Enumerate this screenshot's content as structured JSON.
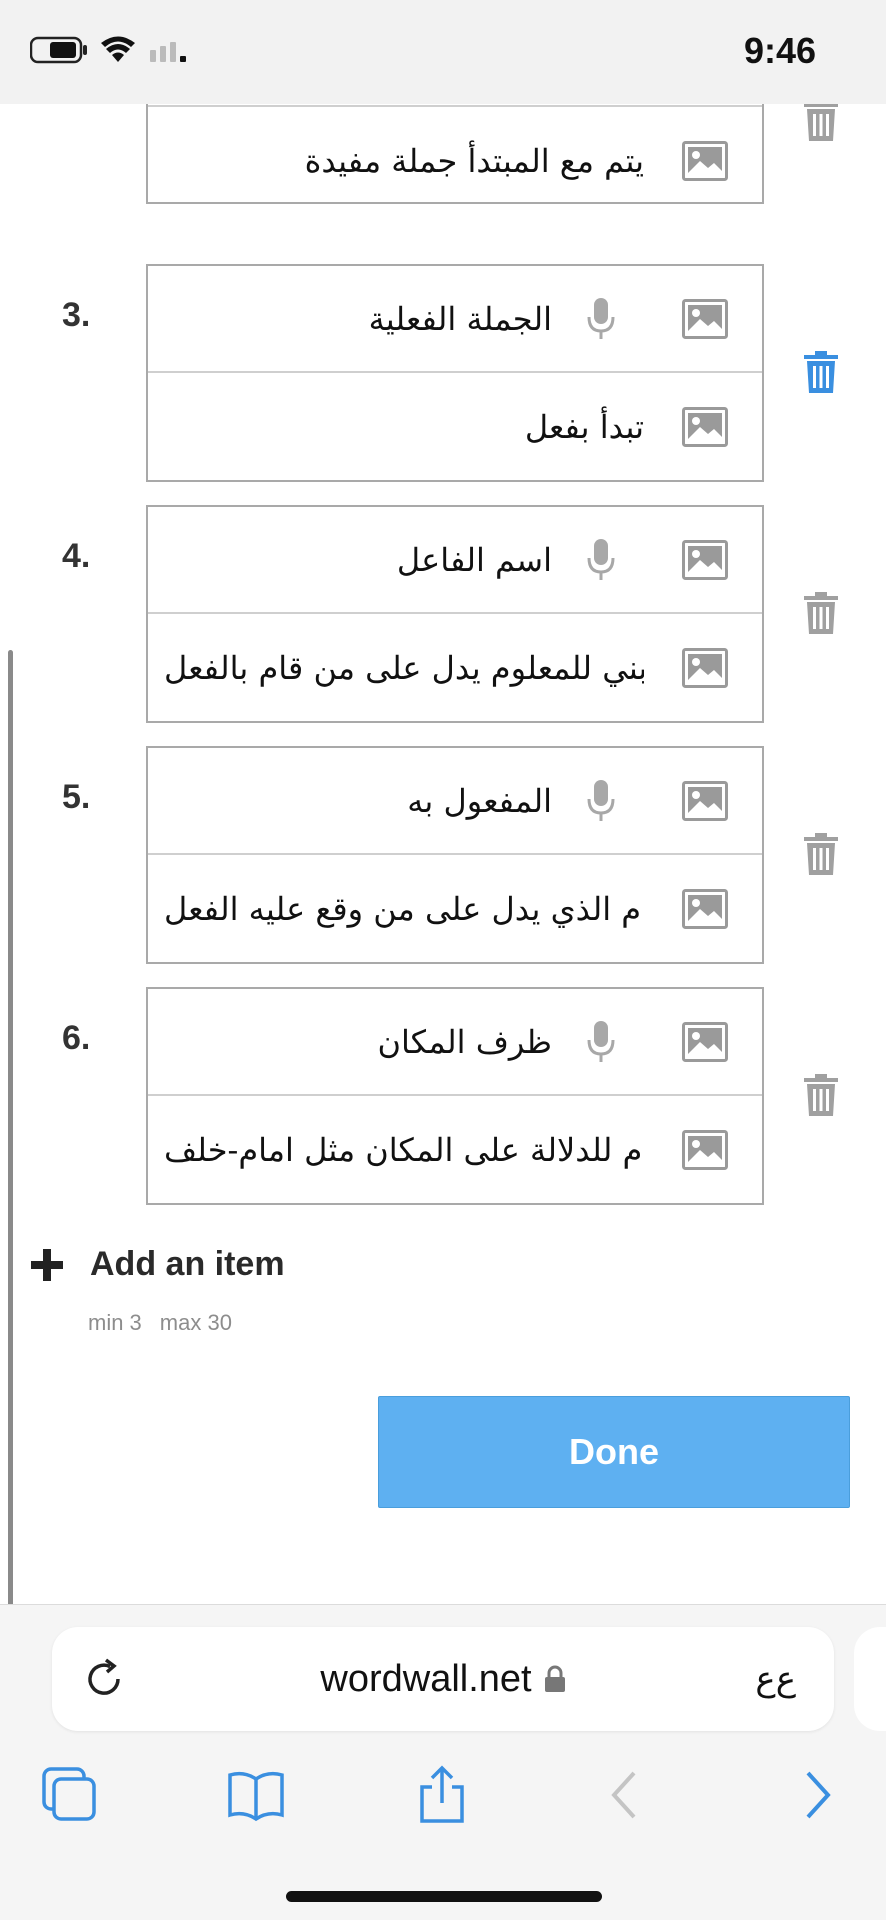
{
  "status": {
    "time": "9:46"
  },
  "items": [
    {
      "number": "",
      "term": "",
      "definition": "يتم مع المبتدأ جملة مفيدة",
      "active": false
    },
    {
      "number": "3.",
      "term": "الجملة الفعلية",
      "definition": "تبدأ بفعل",
      "active": true
    },
    {
      "number": "4.",
      "term": "اسم الفاعل",
      "definition": "بني للمعلوم يدل على من قام بالفعل",
      "active": false
    },
    {
      "number": "5.",
      "term": "المفعول به",
      "definition": "م الذي يدل على من وقع عليه الفعل",
      "active": false
    },
    {
      "number": "6.",
      "term": "ظرف المكان",
      "definition": "م للدلالة على المكان مثل امام-خلف",
      "active": false
    }
  ],
  "add_item": {
    "label": "Add an item",
    "min": "min 3",
    "max": "max 30"
  },
  "done_label": "Done",
  "browser": {
    "url": "wordwall.net",
    "aa": "ﻉﻉ"
  },
  "colors": {
    "accent": "#5eb0f1",
    "active_trash": "#3a8fe0",
    "inactive_icon": "#a0a0a0"
  },
  "icons": [
    "image-icon",
    "mic-icon",
    "trash-icon",
    "plus-icon",
    "reload-icon",
    "lock-icon",
    "tabs-icon",
    "bookmarks-icon",
    "share-icon",
    "back-icon",
    "forward-icon"
  ]
}
